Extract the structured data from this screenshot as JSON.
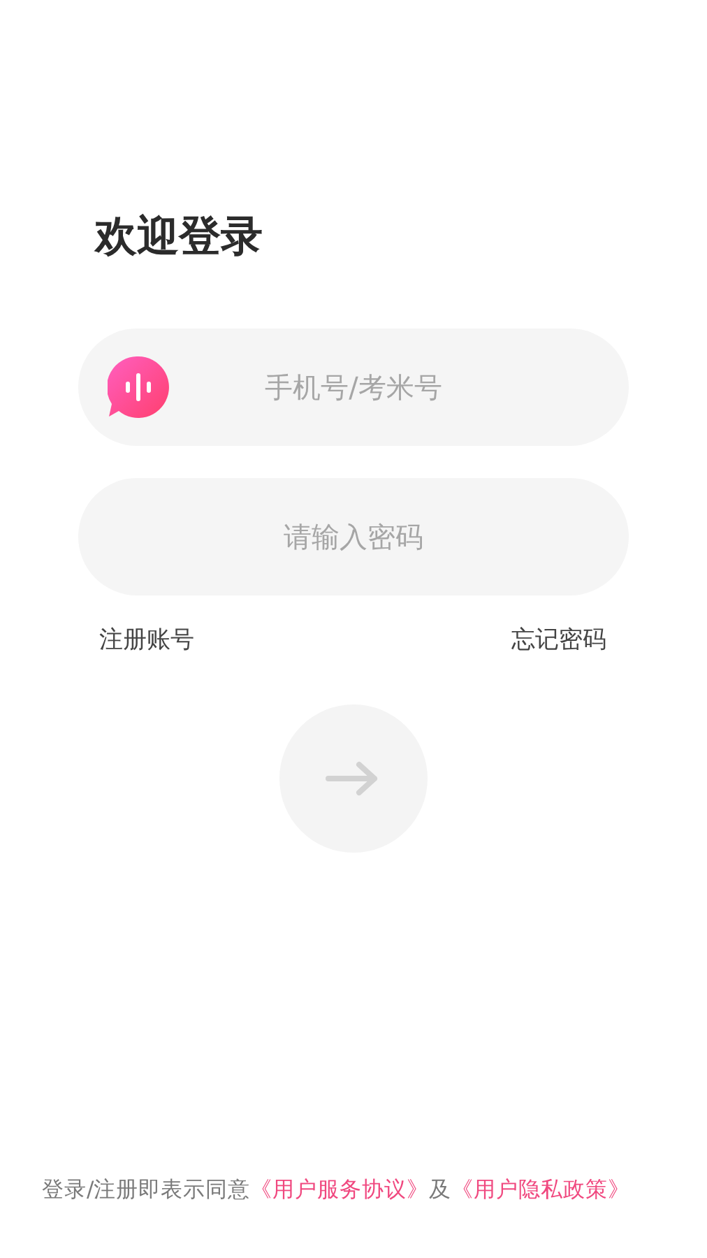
{
  "title": "欢迎登录",
  "fields": [
    {
      "kind": "account",
      "placeholder": "手机号/考米号"
    },
    {
      "kind": "password",
      "placeholder": "请输入密码"
    }
  ],
  "links": [
    "注册账号",
    "忘记密码"
  ],
  "submit": {
    "disabled": true
  },
  "agreement": [
    {
      "kind": "text",
      "text": "登录/注册即表示同意"
    },
    {
      "kind": "link",
      "text": "《用户服务协议》"
    },
    {
      "kind": "text",
      "text": "及"
    },
    {
      "kind": "link",
      "text": "《用户隐私政策》"
    }
  ]
}
